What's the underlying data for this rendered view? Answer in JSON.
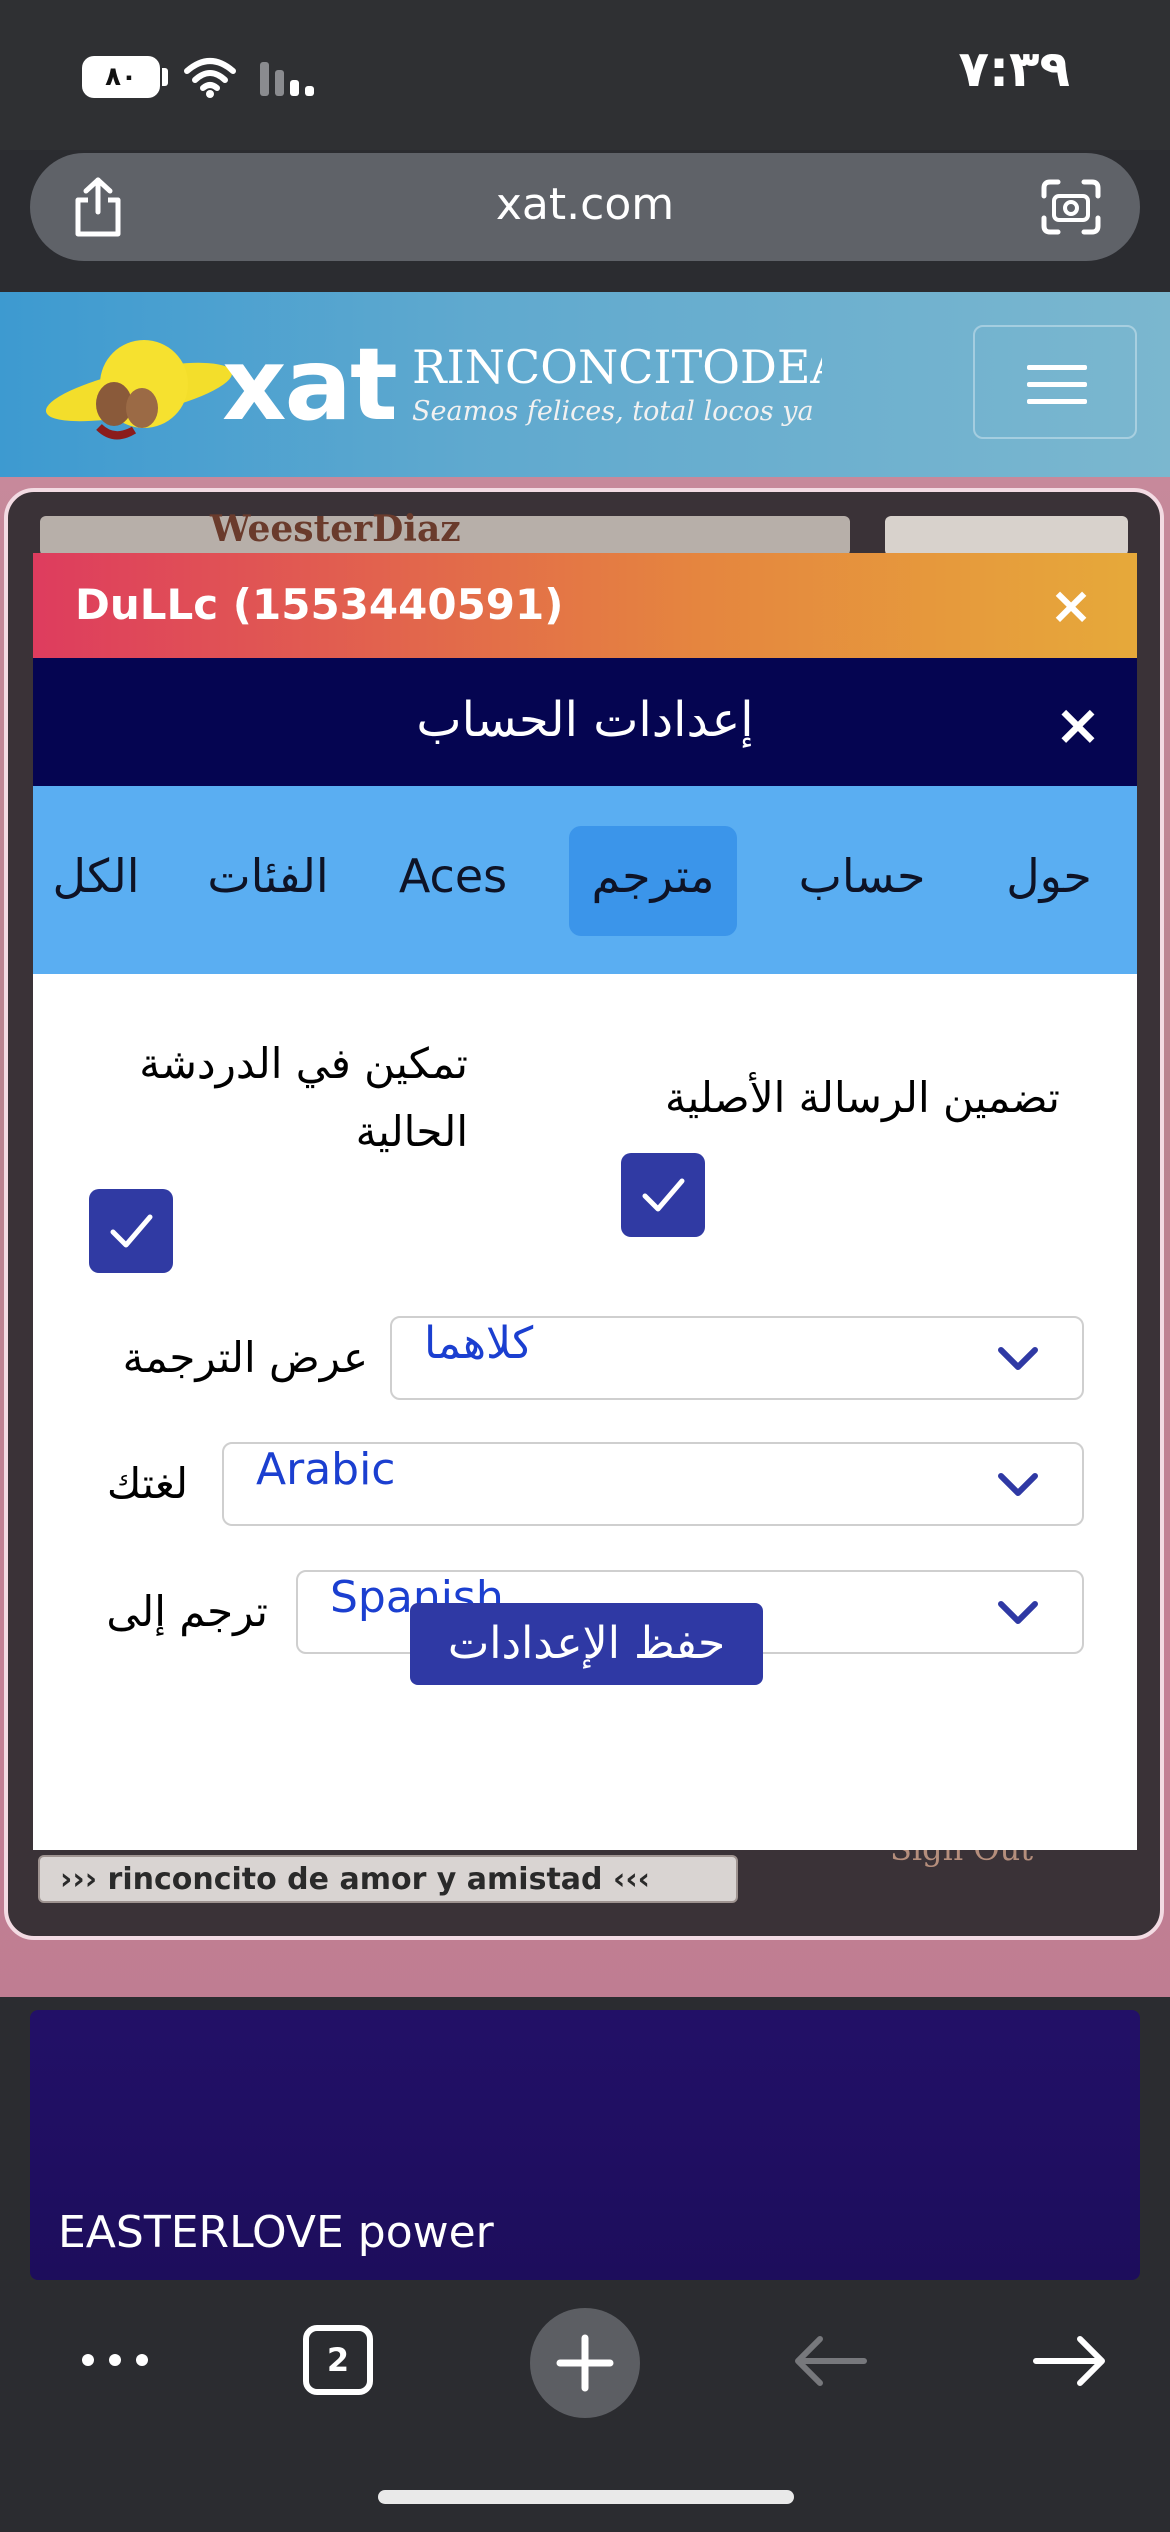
{
  "status_bar": {
    "battery": "٨٠",
    "time": "٧:٣٩"
  },
  "browser": {
    "url": "xat.com",
    "tabs_count": "2"
  },
  "site_header": {
    "logo_text": "xat",
    "room_title": "RINCONCITODEAI",
    "room_subtitle": "Seamos felices, total locos ya"
  },
  "chat": {
    "user_name": "WeesterDiaz",
    "room_bar": "››› rinconcito de amor y amistad ‹‹‹",
    "sign_out": "Sign Out"
  },
  "dialog": {
    "title": "DuLLc (1553440591)",
    "close": "×",
    "settings_title": "إعدادات الحساب",
    "settings_close": "×",
    "tabs": [
      {
        "label": "حول",
        "active": false
      },
      {
        "label": "حساب",
        "active": false
      },
      {
        "label": "مترجم",
        "active": true
      },
      {
        "label": "Aces",
        "active": false
      },
      {
        "label": "الفئات",
        "active": false
      },
      {
        "label": "الكل",
        "active": false
      }
    ],
    "options": {
      "include_original_label": "تضمين الرسالة الأصلية",
      "include_original_checked": true,
      "enable_current_chat_label": "تمكين في الدردشة الحالية",
      "enable_current_chat_checked": true
    },
    "fields": {
      "display_label": "عرض الترجمة",
      "display_value": "كلاهما",
      "language_label": "لغتك",
      "language_value": "Arabic",
      "translate_to_label": "ترجم إلى",
      "translate_to_value": "Spanish"
    },
    "save_button": "حفظ الإعدادات"
  },
  "banner": {
    "text": "EASTERLOVE power"
  },
  "colors": {
    "dialog_header_start": "#de3c5e",
    "dialog_header_end": "#e6a93a",
    "settings_bar": "#050551",
    "tabs_bar": "#5aaef2",
    "accent_blue": "#303aa3",
    "select_text": "#1b3fd0"
  },
  "icons": [
    "battery-icon",
    "wifi-icon",
    "signal-icon",
    "share-icon",
    "camera-icon",
    "menu-icon",
    "check-icon",
    "chevron-down-icon",
    "more-icon",
    "plus-icon",
    "back-arrow-icon",
    "forward-arrow-icon"
  ]
}
